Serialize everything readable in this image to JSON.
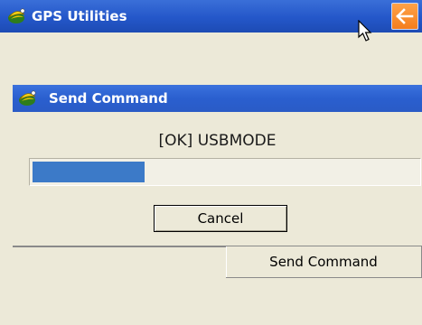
{
  "app": {
    "title": "GPS Utilities",
    "icon": "gps-satellite-icon",
    "back_icon": "back-arrow-icon"
  },
  "dialog": {
    "title": "Send Command",
    "icon": "gps-satellite-icon",
    "status": "[OK] USBMODE",
    "progress_fraction": 0.29,
    "cancel_label": "Cancel"
  },
  "main": {
    "send_command_label": "Send Command"
  },
  "colors": {
    "titlebar": "#2457c9",
    "accent_orange": "#f47e1d",
    "progress": "#3c7ac8",
    "background": "#ece9d8"
  }
}
